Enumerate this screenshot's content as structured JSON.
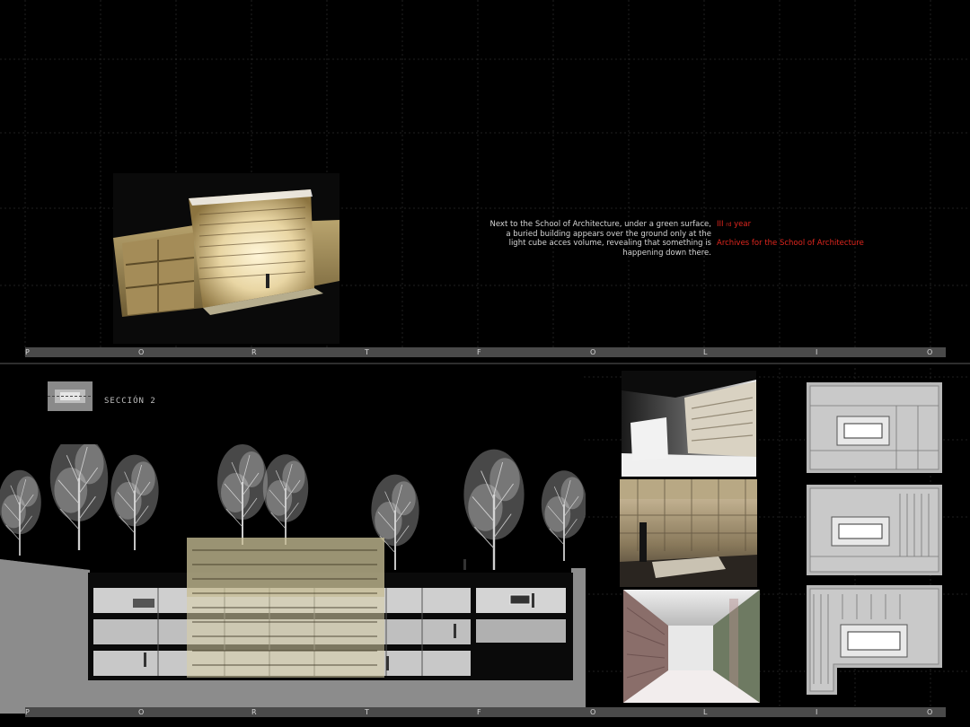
{
  "project": {
    "description_lines": [
      "Next to the School of Architecture, under a green surface,",
      "a buried building appears over the ground only at the",
      "light cube acces volume, revealing that something is",
      "happening down there."
    ],
    "year_main": "III",
    "year_sub": "rd",
    "year_word": "year",
    "title": "Archives for the School of Architecture"
  },
  "portfolio_letters": [
    "P",
    "O",
    "R",
    "T",
    "F",
    "O",
    "L",
    "I",
    "O"
  ],
  "section": {
    "label": "SECCIÓN 2"
  },
  "colors": {
    "background": "#000000",
    "bar": "#4a4a4a",
    "accent_red": "#e0261e",
    "ground": "#8c8c8c"
  }
}
